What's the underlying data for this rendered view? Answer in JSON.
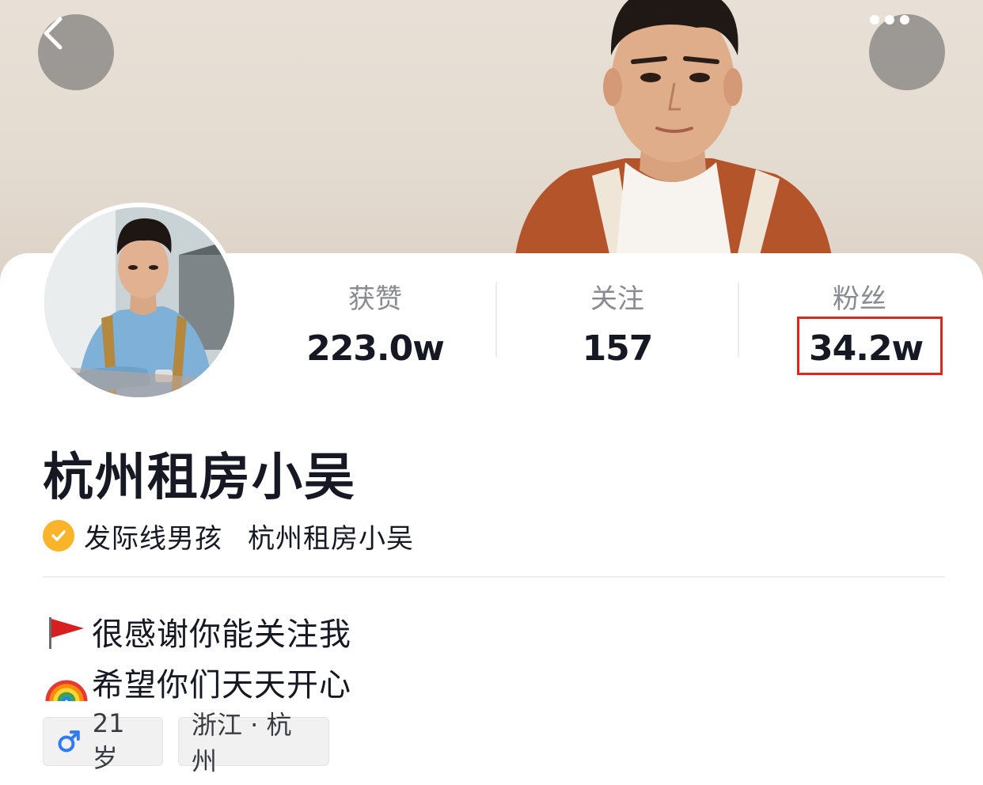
{
  "header": {
    "back_icon": "chevron-left-icon",
    "more_icon": "more-dots-icon"
  },
  "profile": {
    "display_name": "杭州租房小吴",
    "verification": {
      "icon": "verified-check-icon",
      "title": "发际线男孩",
      "org": "杭州租房小吴",
      "color": "#f9b42a"
    }
  },
  "stats": {
    "likes": {
      "label": "获赞",
      "value": "223.0w"
    },
    "following": {
      "label": "关注",
      "value": "157"
    },
    "fans": {
      "label": "粉丝",
      "value": "34.2w",
      "highlight_color": "#e0251c"
    }
  },
  "bio": {
    "lines": [
      {
        "icon": "red-flag-emoji",
        "text": "很感谢你能关注我"
      },
      {
        "icon": "rainbow-emoji",
        "text": "希望你们天天开心"
      }
    ]
  },
  "tags": {
    "gender": {
      "icon": "male-icon",
      "text": "21岁",
      "icon_color": "#2f7bf5"
    },
    "location": {
      "text": "浙江 · 杭州"
    }
  }
}
